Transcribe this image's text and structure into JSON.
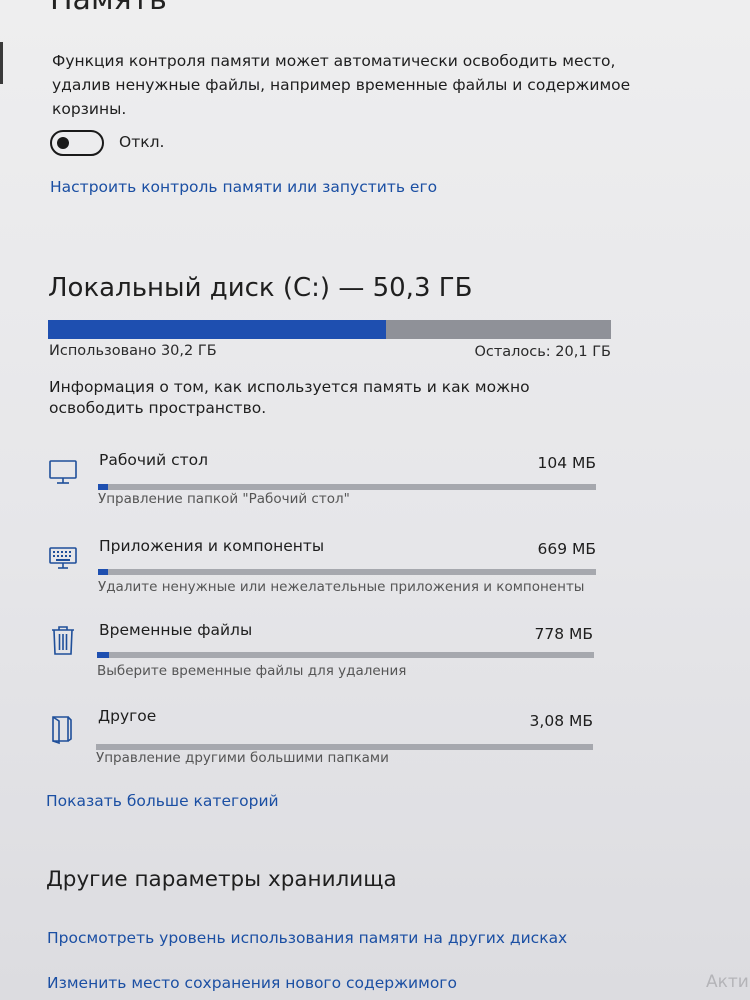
{
  "storage_sense": {
    "title": "Память",
    "description": "Функция контроля памяти может автоматически освободить место, удалив ненужные файлы, например временные файлы и содержимое корзины.",
    "toggle_state": "Откл.",
    "toggle_on": false,
    "configure_link": "Настроить контроль памяти или запустить его"
  },
  "disk": {
    "title": "Локальный диск (С:) — 50,3 ГБ",
    "used_label": "Использовано 30,2 ГБ",
    "free_label": "Осталось: 20,1 ГБ",
    "used_fraction": 0.6,
    "info": "Информация о том, как используется память и как можно освободить пространство."
  },
  "categories": [
    {
      "icon": "monitor-icon",
      "name": "Рабочий стол",
      "size": "104 МБ",
      "fill_fraction": 0.002,
      "subtitle": "Управление папкой \"Рабочий стол\""
    },
    {
      "icon": "keyboard-icon",
      "name": "Приложения и компоненты",
      "size": "669 МБ",
      "fill_fraction": 0.02,
      "subtitle": "Удалите ненужные или нежелательные приложения и компоненты"
    },
    {
      "icon": "trash-icon",
      "name": "Временные файлы",
      "size": "778 МБ",
      "fill_fraction": 0.025,
      "subtitle": "Выберите временные файлы для удаления"
    },
    {
      "icon": "folder-icon",
      "name": "Другое",
      "size": "3,08 МБ",
      "fill_fraction": 0.0,
      "subtitle": "Управление другими большими папками"
    }
  ],
  "show_more_link": "Показать больше категорий",
  "other_settings": {
    "title": "Другие параметры хранилища",
    "link_other_disks": "Просмотреть уровень использования памяти на других дисках",
    "link_change_location": "Изменить место сохранения нового содержимого"
  },
  "watermark": "Акти",
  "colors": {
    "accent": "#1e4fb0",
    "link": "#1b4fa3",
    "bar_bg": "#8f9198"
  }
}
